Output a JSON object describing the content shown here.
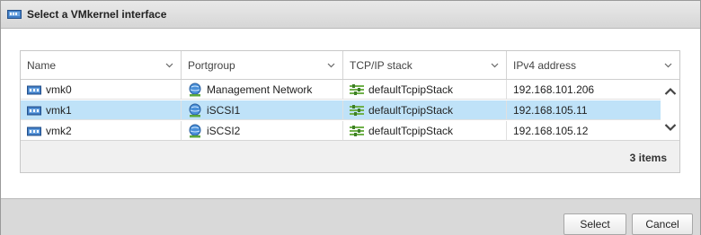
{
  "dialog": {
    "title": "Select a VMkernel interface"
  },
  "table": {
    "columns": [
      "Name",
      "Portgroup",
      "TCP/IP stack",
      "IPv4 address"
    ],
    "rows": [
      {
        "name": "vmk0",
        "portgroup": "Management Network",
        "stack": "defaultTcpipStack",
        "ipv4": "192.168.101.206",
        "selected": false
      },
      {
        "name": "vmk1",
        "portgroup": "iSCSI1",
        "stack": "defaultTcpipStack",
        "ipv4": "192.168.105.11",
        "selected": true
      },
      {
        "name": "vmk2",
        "portgroup": "iSCSI2",
        "stack": "defaultTcpipStack",
        "ipv4": "192.168.105.12",
        "selected": false
      }
    ],
    "count_label": "3 items"
  },
  "buttons": {
    "select": "Select",
    "cancel": "Cancel"
  },
  "icons": {
    "title": "vmkernel-nic-icon",
    "row": "vmkernel-nic-icon",
    "portgroup": "network-globe-icon",
    "stack": "tcpip-stack-icon"
  },
  "colors": {
    "selected_row": "#bfe2f8",
    "titlebar": "#dcdcdc",
    "bottombar": "#d9d9d9"
  }
}
